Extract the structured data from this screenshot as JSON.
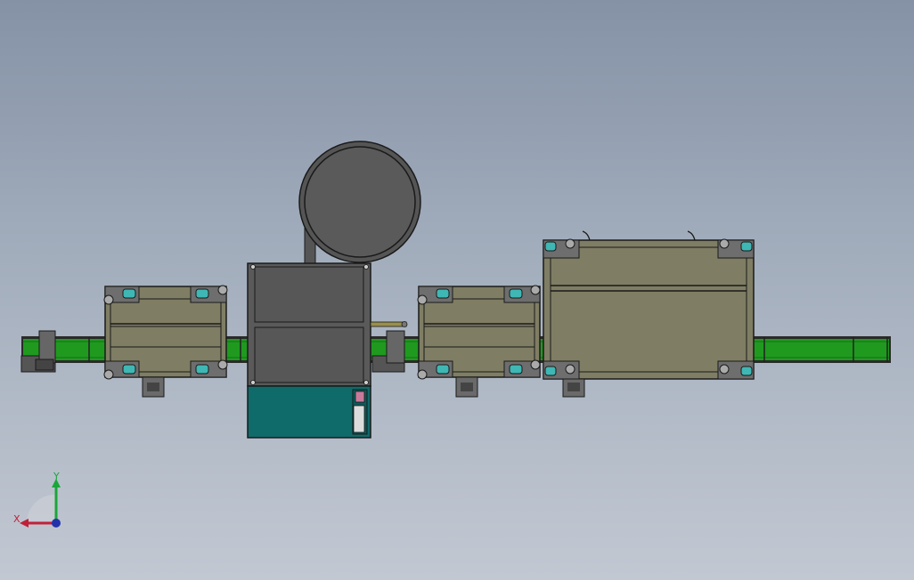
{
  "viewport": {
    "background_top": "#8592a6",
    "background_bottom": "#c2c8d2"
  },
  "colors": {
    "conveyor_belt": "#1f9a1f",
    "frame_dark": "#3a3a3a",
    "panel_olive": "#7f7d63",
    "hopper_gray": "#5a5a5a",
    "control_cabinet": "#0f6b6a",
    "roller_teal": "#3fb7b4"
  },
  "triad": {
    "x_label": "X",
    "y_label": "Y",
    "x_color": "#c0203a",
    "y_color": "#1aa63a",
    "z_color": "#2233aa"
  }
}
